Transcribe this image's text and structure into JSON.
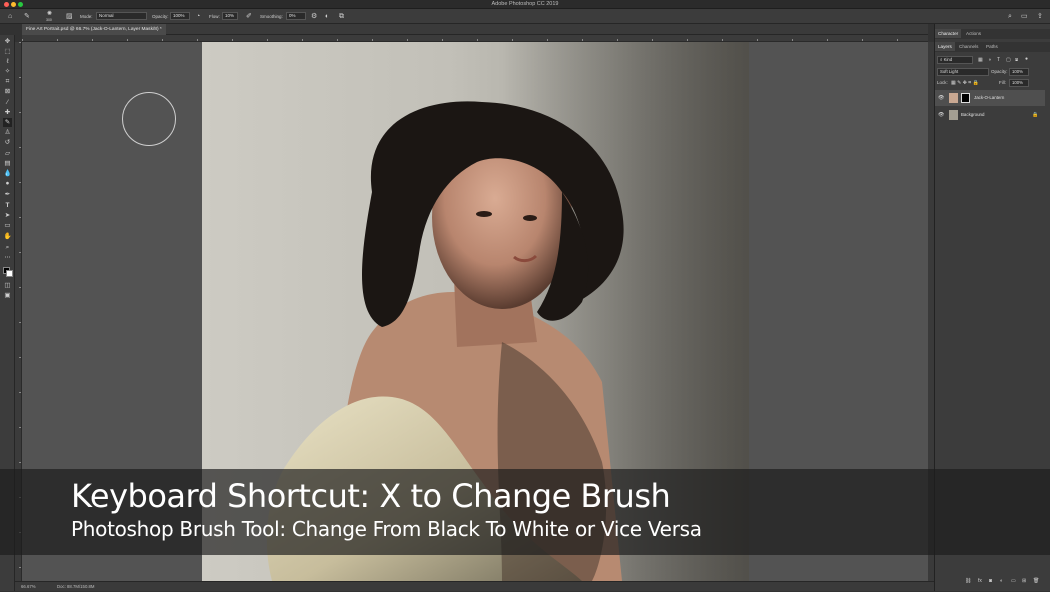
{
  "app": {
    "title": "Adobe Photoshop CC 2019"
  },
  "options_bar": {
    "brush_size": "300",
    "mode_label": "Mode:",
    "mode_value": "Normal",
    "opacity_label": "Opacity:",
    "opacity_value": "100%",
    "flow_label": "Flow:",
    "flow_value": "10%",
    "smoothing_label": "Smoothing:",
    "smoothing_value": "0%"
  },
  "document": {
    "tab_title": "Fine Art Portrait.psd @ 66.7% (Jack-O-Lantern, Layer Mask/8) *"
  },
  "status": {
    "zoom": "66.67%",
    "doc_info": "Doc: 88.7M/150.8M"
  },
  "panels": {
    "top_tabs": [
      "Character",
      "Actions"
    ],
    "layer_tabs": [
      "Layers",
      "Channels",
      "Paths"
    ],
    "filter_kind": "Kind",
    "blend_mode": "Soft Light",
    "opacity_label": "Opacity:",
    "opacity_value": "100%",
    "lock_label": "Lock:",
    "fill_label": "Fill:",
    "fill_value": "100%",
    "layers": [
      {
        "name": "Jack-O-Lantern"
      },
      {
        "name": "Background"
      }
    ]
  },
  "caption": {
    "title": "Keyboard Shortcut: X to Change Brush",
    "subtitle": "Photoshop Brush Tool: Change From Black To White or Vice Versa"
  }
}
